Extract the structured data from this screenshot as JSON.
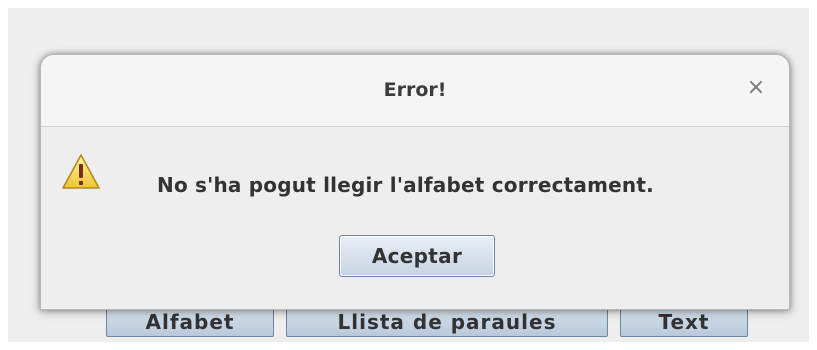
{
  "background_window": {
    "buttons": [
      {
        "label": "Alfabet"
      },
      {
        "label": "Llista de paraules"
      },
      {
        "label": "Text"
      }
    ]
  },
  "dialog": {
    "title": "Error!",
    "close_glyph": "×",
    "icon": "warning-icon",
    "message": "No s'ha pogut llegir l'alfabet correctament.",
    "ok_label": "Aceptar"
  },
  "colors": {
    "warning_fill": "#f5d547",
    "warning_stroke": "#b48a1e",
    "button_border": "#6b86a4"
  }
}
